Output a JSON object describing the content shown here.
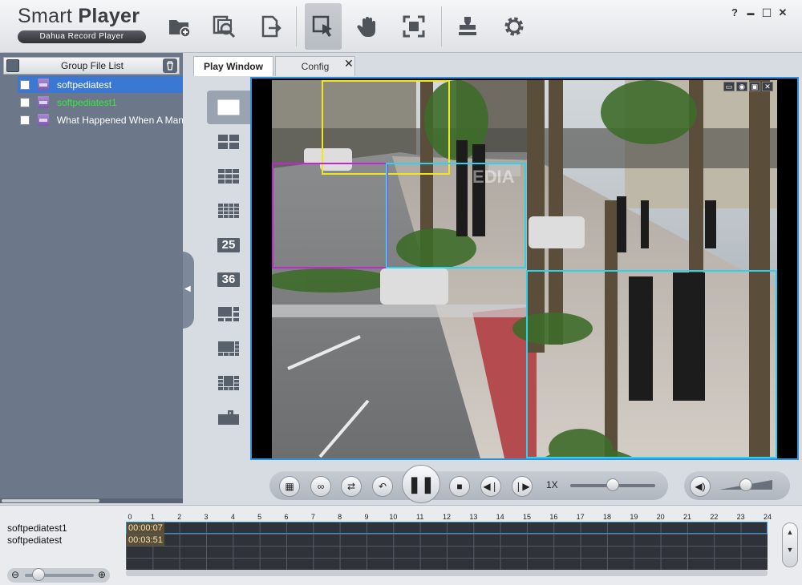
{
  "app": {
    "title_light": "Smart ",
    "title_bold": "Player",
    "subtitle": "Dahua Record Player"
  },
  "toolbar": {
    "buttons": [
      {
        "name": "open-folder-icon",
        "active": false
      },
      {
        "name": "search-file-icon",
        "active": false
      },
      {
        "name": "export-file-icon",
        "active": false
      },
      {
        "name": "select-cursor-icon",
        "active": true
      },
      {
        "name": "hand-pan-icon",
        "active": false
      },
      {
        "name": "fullscreen-icon",
        "active": false
      },
      {
        "name": "stamp-icon",
        "active": false
      },
      {
        "name": "gear-icon",
        "active": false
      }
    ],
    "window_controls": {
      "help": "?",
      "minimize": "▬",
      "maximize": "☐",
      "close": "✕"
    }
  },
  "file_list": {
    "header": "Group File List",
    "files": [
      {
        "name": "softpediatest",
        "selected": true,
        "color": "#ffffff"
      },
      {
        "name": "softpediatest1",
        "selected": false,
        "color": "#36e83a"
      },
      {
        "name": "What Happened When A Man",
        "selected": false,
        "color": "#ffffff"
      }
    ]
  },
  "tabs": {
    "play_window": "Play Window",
    "config": "Config",
    "close": "✕"
  },
  "layouts": {
    "label_25": "25",
    "label_36": "36"
  },
  "video": {
    "watermark": "EDIA",
    "detections": [
      {
        "color": "#f2e61a"
      },
      {
        "color": "#c325d6"
      },
      {
        "color": "#2ad4ee"
      },
      {
        "color": "#2ad4ee"
      }
    ]
  },
  "playback": {
    "speed": "1X",
    "speed_slider_level": 0.5,
    "volume_level": 0.5
  },
  "timeline": {
    "channels": [
      "softpediatest1",
      "softpediatest"
    ],
    "hour_labels": [
      "0",
      "1",
      "2",
      "3",
      "4",
      "5",
      "6",
      "7",
      "8",
      "9",
      "10",
      "11",
      "12",
      "13",
      "14",
      "15",
      "16",
      "17",
      "18",
      "19",
      "20",
      "21",
      "22",
      "23",
      "24"
    ],
    "segment_times": [
      "00:00:07",
      "00:03:51"
    ],
    "zoom_level": 0.2
  }
}
